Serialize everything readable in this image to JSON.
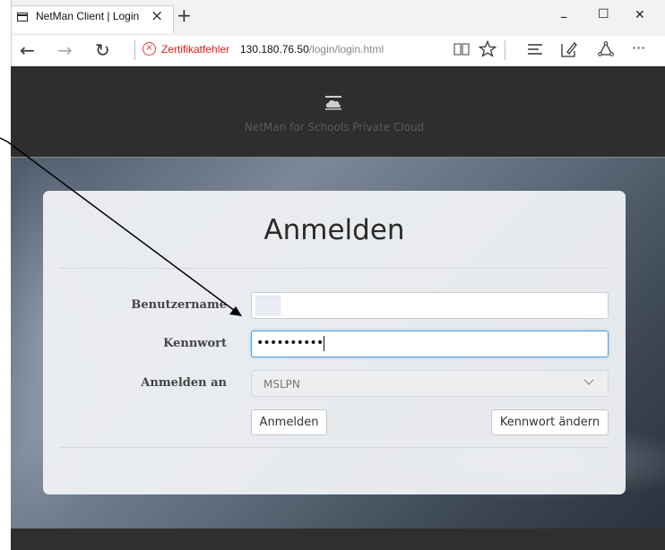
{
  "browser": {
    "tab_title": "NetMan Client | Login",
    "tab_close_glyph": "×",
    "new_tab_glyph": "+",
    "window_controls": {
      "minimize": "–",
      "maximize": "☐",
      "close": "✕"
    },
    "nav": {
      "back": "←",
      "forward": "→",
      "refresh": "↻",
      "more": "···"
    },
    "cert_error_label": "Zertifikatfehler",
    "url_host": "130.180.76.50",
    "url_path": "/login/login.html",
    "icons": [
      "tab-page-icon",
      "back-arrow-icon",
      "forward-arrow-icon",
      "refresh-icon",
      "certificate-warning-icon",
      "reading-view-icon",
      "favorite-star-icon",
      "hub-icon",
      "web-note-icon",
      "share-icon",
      "more-icon"
    ]
  },
  "header": {
    "logo_icon": "cloud-icon",
    "title": "NetMan for Schools Private Cloud"
  },
  "login": {
    "title": "Anmelden",
    "username_label": "Benutzername",
    "username_value": "",
    "password_label": "Kennwort",
    "password_value_masked": "••••••••••",
    "domain_label": "Anmelden an",
    "domain_selected": "MSLPN",
    "login_button": "Anmelden",
    "change_password_button": "Kennwort ändern"
  },
  "colors": {
    "header_bg": "#2e2e2e",
    "card_bg": "#eef0f3",
    "focus_border": "#5aa0d8",
    "cert_error": "#e31a1a"
  }
}
